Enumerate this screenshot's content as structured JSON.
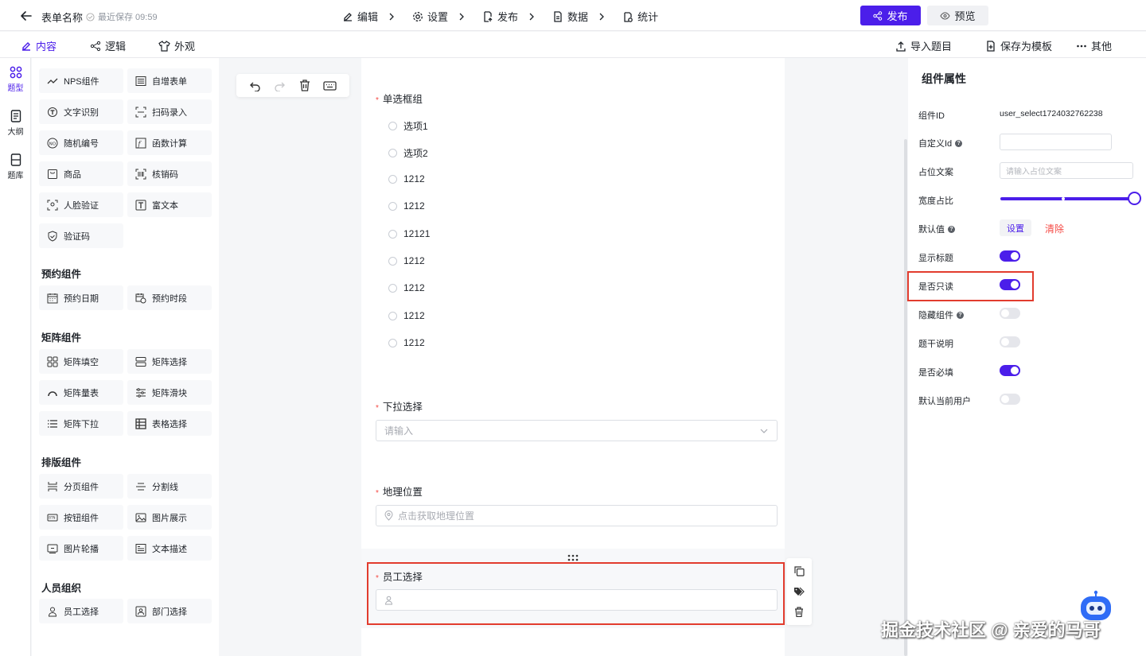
{
  "header": {
    "form_name": "表单名称",
    "last_saved": "最近保存 09:59",
    "steps": [
      {
        "label": "编辑",
        "icon": "edit-icon"
      },
      {
        "label": "设置",
        "icon": "gear-icon"
      },
      {
        "label": "发布",
        "icon": "publish-doc-icon"
      },
      {
        "label": "数据",
        "icon": "data-doc-icon"
      },
      {
        "label": "统计",
        "icon": "stats-icon"
      }
    ],
    "publish_label": "发布",
    "preview_label": "预览",
    "accent": "#4b1eea"
  },
  "subbar": {
    "tabs": [
      {
        "label": "内容",
        "active": true
      },
      {
        "label": "逻辑",
        "active": false
      },
      {
        "label": "外观",
        "active": false
      }
    ],
    "actions": [
      "导入题目",
      "保存为模板",
      "其他"
    ]
  },
  "rail": [
    {
      "label": "题型",
      "active": true
    },
    {
      "label": "大纲",
      "active": false
    },
    {
      "label": "题库",
      "active": false
    }
  ],
  "palette": {
    "advanced": [
      "NPS组件",
      "自增表单",
      "文字识别",
      "扫码录入",
      "随机编号",
      "函数计算",
      "商品",
      "核销码",
      "人脸验证",
      "富文本",
      "验证码"
    ],
    "sections": [
      {
        "title": "预约组件",
        "items": [
          "预约日期",
          "预约时段"
        ]
      },
      {
        "title": "矩阵组件",
        "items": [
          "矩阵填空",
          "矩阵选择",
          "矩阵量表",
          "矩阵滑块",
          "矩阵下拉",
          "表格选择"
        ]
      },
      {
        "title": "排版组件",
        "items": [
          "分页组件",
          "分割线",
          "按钮组件",
          "图片展示",
          "图片轮播",
          "文本描述"
        ]
      },
      {
        "title": "人员组织",
        "items": [
          "员工选择",
          "部门选择"
        ]
      }
    ]
  },
  "form": {
    "radio_group": {
      "label": "单选框组",
      "options": [
        "选项1",
        "选项2",
        "1212",
        "1212",
        "12121",
        "1212",
        "1212",
        "1212",
        "1212"
      ]
    },
    "dropdown": {
      "label": "下拉选择",
      "placeholder": "请输入"
    },
    "location": {
      "label": "地理位置",
      "placeholder": "点击获取地理位置"
    },
    "employee": {
      "label": "员工选择"
    },
    "required_mark": "*"
  },
  "properties": {
    "title": "组件属性",
    "component_id_label": "组件ID",
    "component_id_value": "user_select1724032762238",
    "custom_id_label": "自定义Id",
    "placeholder_label": "占位文案",
    "placeholder_hint": "请输入占位文案",
    "width_label": "宽度占比",
    "width_value": 1.0,
    "default_label": "默认值",
    "default_set": "设置",
    "default_clear": "清除",
    "toggles": [
      {
        "label": "显示标题",
        "on": true,
        "help": false
      },
      {
        "label": "是否只读",
        "on": true,
        "help": false
      },
      {
        "label": "隐藏组件",
        "on": false,
        "help": true
      },
      {
        "label": "题干说明",
        "on": false,
        "help": false
      },
      {
        "label": "是否必填",
        "on": true,
        "help": false
      },
      {
        "label": "默认当前用户",
        "on": false,
        "help": false
      }
    ]
  },
  "watermark": "掘金技术社区 @ 亲爱的马哥"
}
